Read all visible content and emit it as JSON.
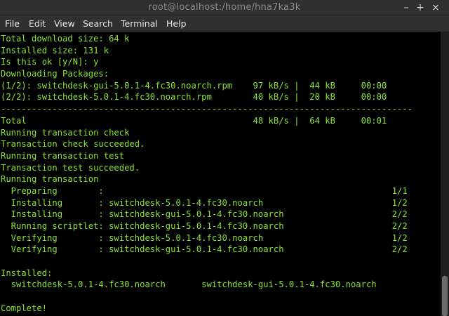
{
  "window": {
    "title": "root@localhost:/home/hna7ka3k",
    "minimize_glyph": "–",
    "maximize_glyph": "+",
    "close_glyph": "×"
  },
  "menu": {
    "items": [
      {
        "label": "File"
      },
      {
        "label": "Edit"
      },
      {
        "label": "View"
      },
      {
        "label": "Search"
      },
      {
        "label": "Terminal"
      },
      {
        "label": "Help"
      }
    ]
  },
  "terminal": {
    "text_color": "#8ae234",
    "background_color": "#000000",
    "lines": [
      "Total download size: 64 k",
      "Installed size: 131 k",
      "Is this ok [y/N]: y",
      "Downloading Packages:",
      "(1/2): switchdesk-gui-5.0.1-4.fc30.noarch.rpm    97 kB/s |  44 kB     00:00",
      "(2/2): switchdesk-5.0.1-4.fc30.noarch.rpm        40 kB/s |  20 kB     00:00",
      "--------------------------------------------------------------------------------",
      "Total                                            48 kB/s |  64 kB     00:01",
      "Running transaction check",
      "Transaction check succeeded.",
      "Running transaction test",
      "Transaction test succeeded.",
      "Running transaction",
      "  Preparing        :                                                        1/1",
      "  Installing       : switchdesk-5.0.1-4.fc30.noarch                         1/2",
      "  Installing       : switchdesk-gui-5.0.1-4.fc30.noarch                     2/2",
      "  Running scriptlet: switchdesk-gui-5.0.1-4.fc30.noarch                     2/2",
      "  Verifying        : switchdesk-5.0.1-4.fc30.noarch                         1/2",
      "  Verifying        : switchdesk-gui-5.0.1-4.fc30.noarch                     2/2",
      "",
      "Installed:",
      "  switchdesk-5.0.1-4.fc30.noarch       switchdesk-gui-5.0.1-4.fc30.noarch",
      "",
      "Complete!"
    ]
  },
  "scrollbar": {
    "thumb_start_fraction": 0.86,
    "thumb_size_fraction": 0.14
  }
}
